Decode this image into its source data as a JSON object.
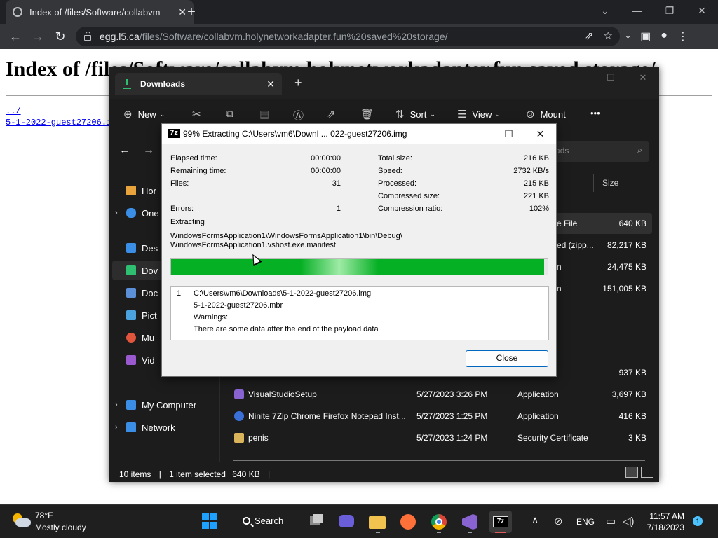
{
  "browser": {
    "tab_title": "Index of /files/Software/collabvm",
    "tab_close": "✕",
    "new_tab": "+",
    "url_host": "egg.l5.ca",
    "url_path": "/files/Software/collabvm.holynetworkadapter.fun%20saved%20storage/",
    "back": "←",
    "forward": "→",
    "reload": "↻",
    "win_dropdown": "⌄",
    "win_min": "—",
    "win_max": "❐",
    "win_close": "✕"
  },
  "page": {
    "heading": "Index of /files/Software/collabvm.holynetworkadapter.fun saved storage/",
    "links": [
      "../",
      "5-1-2022-guest27206.i"
    ]
  },
  "explorer": {
    "tab_title": "Downloads",
    "tab_close": "✕",
    "new_tab": "+",
    "win_min": "—",
    "win_max": "☐",
    "win_close": "✕",
    "cmd_new": "New",
    "cmd_sort": "Sort",
    "cmd_view": "View",
    "cmd_mount": "Mount",
    "cmd_more": "•••",
    "search_placeholder": "nloads",
    "col_size": "Size",
    "nav_items": [
      {
        "label": "Hor",
        "color": "#e8a33d"
      },
      {
        "label": "One",
        "color": "#3a8ee6"
      },
      {
        "label": "Des",
        "color": "#3a8ee6"
      },
      {
        "label": "Dov",
        "color": "#2fbf71"
      },
      {
        "label": "Doc",
        "color": "#5b8fd8"
      },
      {
        "label": "Pict",
        "color": "#4aa3df"
      },
      {
        "label": "Mu",
        "color": "#e0553c"
      },
      {
        "label": "Vid",
        "color": "#9b59d0"
      },
      {
        "label": "My Computer",
        "color": "#3a8ee6"
      },
      {
        "label": "Network",
        "color": "#3a8ee6"
      }
    ],
    "partial_rows": [
      {
        "type": "e File",
        "size": "640 KB"
      },
      {
        "type": "ed (zipp...",
        "size": "82,217 KB"
      },
      {
        "type": "n",
        "size": "24,475 KB"
      },
      {
        "type": "n",
        "size": "151,005 KB"
      },
      {
        "type": "",
        "size": "937 KB"
      }
    ],
    "rows": [
      {
        "name": "VisualStudioSetup",
        "date": "5/27/2023 3:26 PM",
        "type": "Application",
        "size": "3,697 KB",
        "icon": "#8a63d2"
      },
      {
        "name": "Ninite 7Zip Chrome Firefox Notepad Inst...",
        "date": "5/27/2023 1:25 PM",
        "type": "Application",
        "size": "416 KB",
        "icon": "#3a6fd8"
      },
      {
        "name": "penis",
        "date": "5/27/2023 1:24 PM",
        "type": "Security Certificate",
        "size": "3 KB",
        "icon": "#d9b45a"
      }
    ],
    "status_items": "10 items",
    "status_selected": "1 item selected",
    "status_size": "640 KB"
  },
  "dialog": {
    "title": "99% Extracting C:\\Users\\vm6\\Downl ... 022-guest27206.img",
    "app_icon_text": "7z",
    "btn_min": "—",
    "btn_max": "☐",
    "btn_close": "✕",
    "left_stats": [
      {
        "label": "Elapsed time:",
        "value": "00:00:00"
      },
      {
        "label": "Remaining time:",
        "value": "00:00:00"
      },
      {
        "label": "Files:",
        "value": "31"
      },
      {
        "label": "Errors:",
        "value": "1"
      }
    ],
    "right_stats": [
      {
        "label": "Total size:",
        "value": "216 KB"
      },
      {
        "label": "Speed:",
        "value": "2732 KB/s"
      },
      {
        "label": "Processed:",
        "value": "215 KB"
      },
      {
        "label": "Compressed size:",
        "value": "221 KB"
      },
      {
        "label": "Compression ratio:",
        "value": "102%"
      }
    ],
    "action": "Extracting",
    "current_path_1": "WindowsFormsApplication1\\WindowsFormsApplication1\\bin\\Debug\\",
    "current_path_2": "WindowsFormsApplication1.vshost.exe.manifest",
    "progress_percent": 99,
    "messages": {
      "index": "1",
      "line1": "C:\\Users\\vm6\\Downloads\\5-1-2022-guest27206.img",
      "line2": "5-1-2022-guest27206.mbr",
      "line3": "Warnings:",
      "line4": "There are some data after the end of the payload data"
    },
    "close_label": "Close"
  },
  "taskbar": {
    "temp": "78°F",
    "weather": "Mostly cloudy",
    "search_label": "Search",
    "lang": "ENG",
    "time": "11:57 AM",
    "date": "7/18/2023",
    "notifications": "1",
    "tray_chevron": "∧"
  }
}
